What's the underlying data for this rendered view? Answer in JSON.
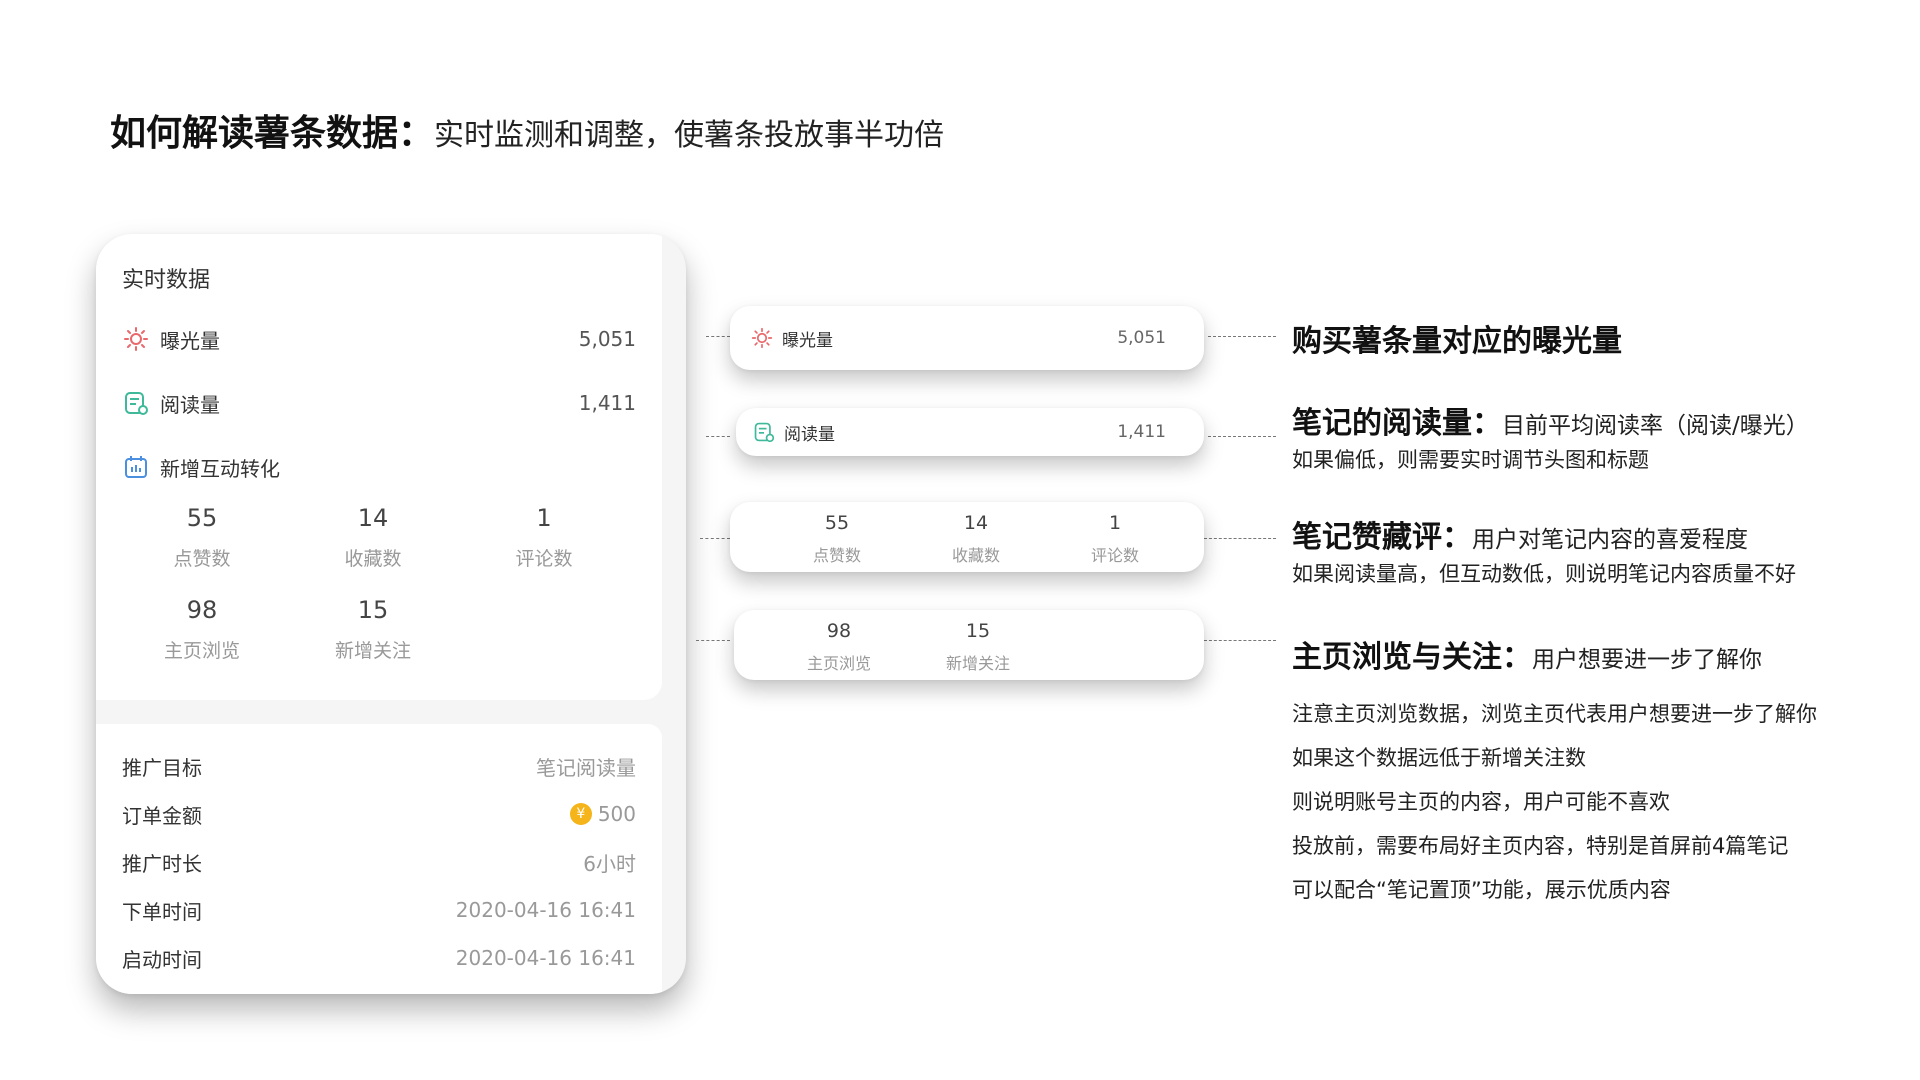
{
  "title": {
    "bold": "如何解读薯条数据：",
    "normal": "实时监测和调整，使薯条投放事半功倍"
  },
  "realtime": {
    "title": "实时数据",
    "exposure": {
      "label": "曝光量",
      "value": "5,051"
    },
    "reads": {
      "label": "阅读量",
      "value": "1,411"
    },
    "interaction": {
      "label": "新增互动转化"
    },
    "stats": [
      {
        "num": "55",
        "cap": "点赞数"
      },
      {
        "num": "14",
        "cap": "收藏数"
      },
      {
        "num": "1",
        "cap": "评论数"
      },
      {
        "num": "98",
        "cap": "主页浏览"
      },
      {
        "num": "15",
        "cap": "新增关注"
      }
    ]
  },
  "order": {
    "rows": [
      {
        "k": "推广目标",
        "v": "笔记阅读量"
      },
      {
        "k": "订单金额",
        "v": "500"
      },
      {
        "k": "推广时长",
        "v": "6小时"
      },
      {
        "k": "下单时间",
        "v": "2020-04-16 16:41"
      },
      {
        "k": "启动时间",
        "v": "2020-04-16 16:41"
      }
    ]
  },
  "annotations": {
    "a1": {
      "heading": "购买薯条量对应的曝光量"
    },
    "a2": {
      "heading": "笔记的阅读量：",
      "sub": "目前平均阅读率（阅读/曝光）",
      "line1": "如果偏低，则需要实时调节头图和标题"
    },
    "a3": {
      "heading": "笔记赞藏评：",
      "sub": "用户对笔记内容的喜爱程度",
      "line1": "如果阅读量高，但互动数低，则说明笔记内容质量不好"
    },
    "a4": {
      "heading": "主页浏览与关注：",
      "sub": "用户想要进一步了解你",
      "lines": [
        "注意主页浏览数据，浏览主页代表用户想要进一步了解你",
        "如果这个数据远低于新增关注数",
        "则说明账号主页的内容，用户可能不喜欢",
        "投放前，需要布局好主页内容，特别是首屏前4篇笔记",
        "可以配合“笔记置顶”功能，展示优质内容"
      ]
    }
  },
  "colors": {
    "exposure_icon": "#e9686b",
    "reads_icon": "#3fb99a",
    "interaction_icon": "#4a8fe0",
    "coin": "#f4b41a"
  },
  "icons": {
    "exposure": "sun-icon",
    "reads": "document-eye-icon",
    "interaction": "calendar-chart-icon",
    "coin": "coin-icon"
  }
}
